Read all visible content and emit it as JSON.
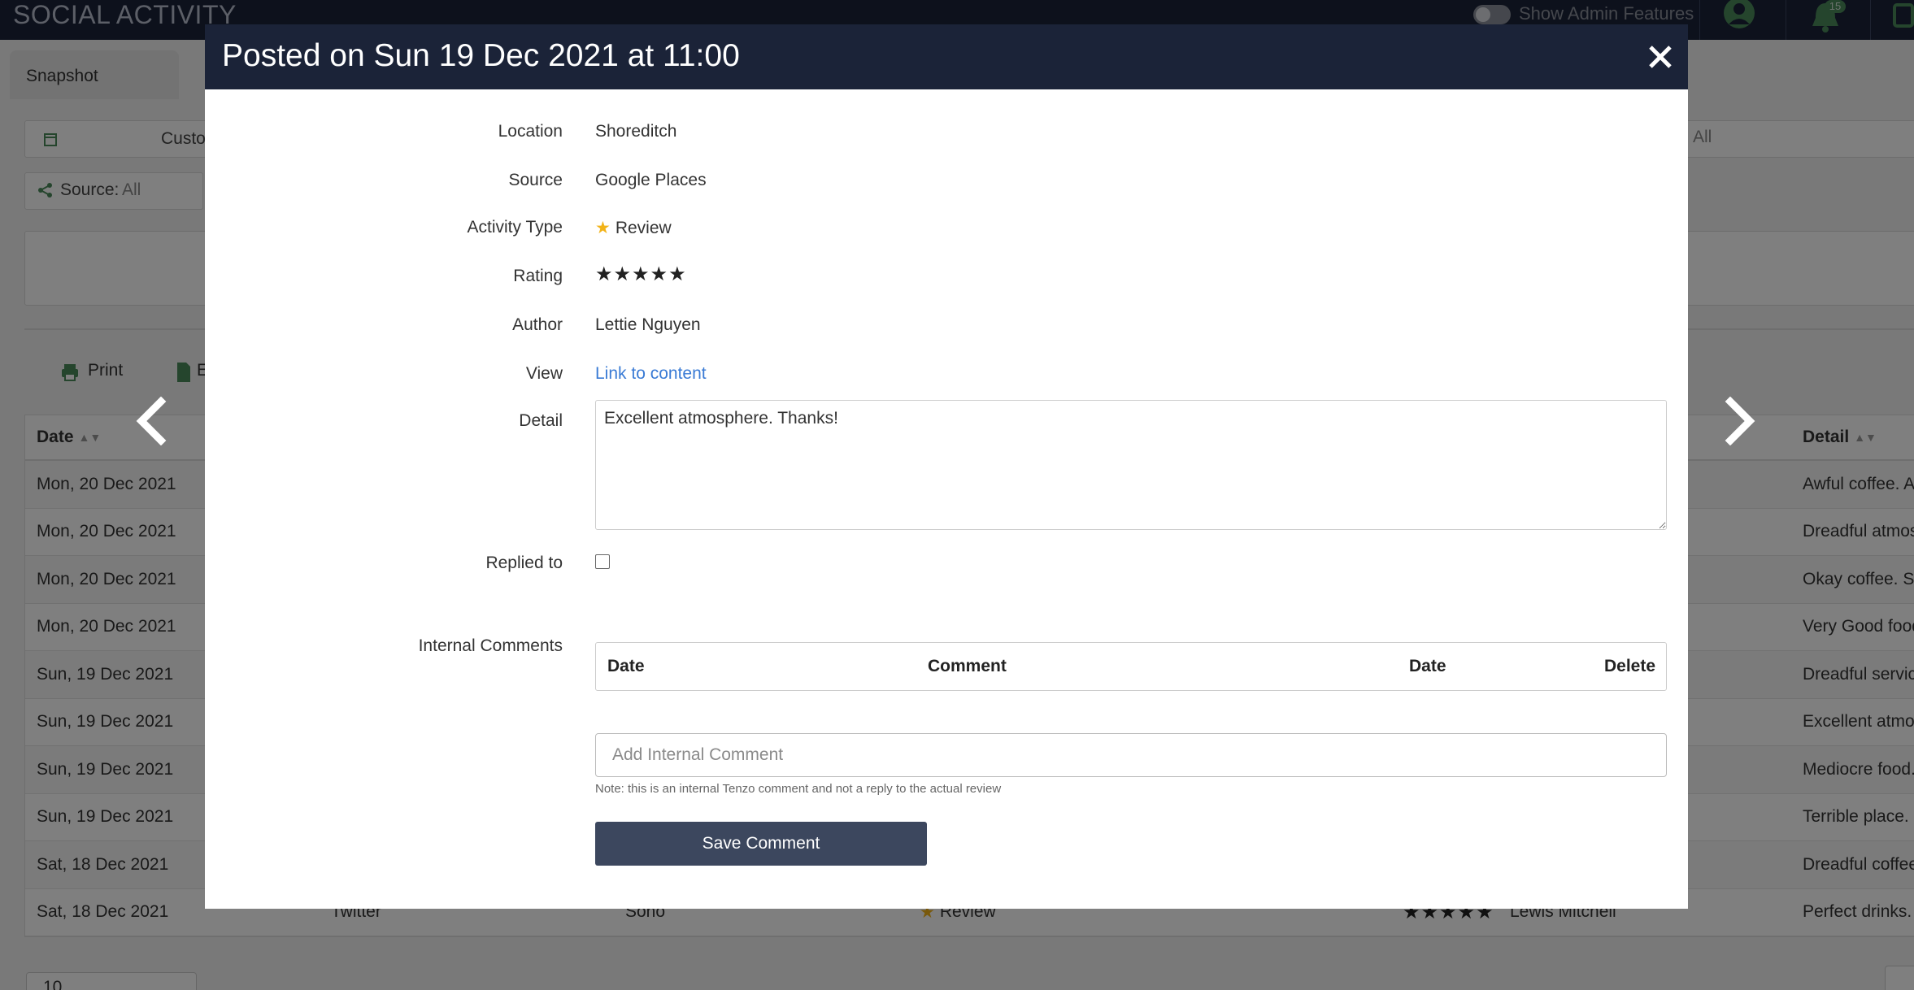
{
  "app": {
    "title": "SOCIAL ACTIVITY",
    "admin_toggle_label": "Show Admin Features",
    "notification_count": "15"
  },
  "tabs": {
    "snapshot": "Snapshot"
  },
  "filters": {
    "date_range": "Custo",
    "source_label": "Source:",
    "source_value": "All",
    "right_value": "All"
  },
  "toolbar": {
    "print": "Print",
    "export": "E"
  },
  "table": {
    "headers": {
      "date": "Date",
      "detail": "Detail"
    },
    "rows": [
      {
        "date": "Mon, 20 Dec 2021",
        "detail": "Awful coffee. A"
      },
      {
        "date": "Mon, 20 Dec 2021",
        "detail": "Dreadful atmos"
      },
      {
        "date": "Mon, 20 Dec 2021",
        "detail": "Okay coffee. Se"
      },
      {
        "date": "Mon, 20 Dec 2021",
        "detail": "Very Good food"
      },
      {
        "date": "Sun, 19 Dec 2021",
        "detail": "Dreadful servic"
      },
      {
        "date": "Sun, 19 Dec 2021",
        "detail": "Excellent atmo"
      },
      {
        "date": "Sun, 19 Dec 2021",
        "detail": "Mediocre food."
      },
      {
        "date": "Sun, 19 Dec 2021",
        "detail": "Terrible place. I"
      },
      {
        "date": "Sat, 18 Dec 2021",
        "detail": "Dreadful coffee"
      },
      {
        "date": "Sat, 18 Dec 2021",
        "source": "Twitter",
        "location": "Soho",
        "type": "Review",
        "rating": "★★★★★",
        "author": "Lewis Mitchell",
        "detail": "Perfect drinks."
      }
    ],
    "page_size": "10"
  },
  "modal": {
    "title": "Posted on Sun 19 Dec 2021 at 11:00",
    "labels": {
      "location": "Location",
      "source": "Source",
      "activity_type": "Activity Type",
      "rating": "Rating",
      "author": "Author",
      "view": "View",
      "detail": "Detail",
      "replied_to": "Replied to",
      "internal_comments": "Internal Comments"
    },
    "values": {
      "location": "Shoreditch",
      "source": "Google Places",
      "activity_type": "Review",
      "rating": "★★★★★",
      "author": "Lettie Nguyen",
      "view_link": "Link to content",
      "detail": "Excellent atmosphere. Thanks!"
    },
    "replied_to_checked": false,
    "comments_table": {
      "headers": {
        "date": "Date",
        "comment": "Comment",
        "date2": "Date",
        "delete": "Delete"
      }
    },
    "comment_input_placeholder": "Add Internal Comment",
    "note": "Note: this is an internal Tenzo comment and not a reply to the actual review",
    "save_label": "Save Comment"
  },
  "colors": {
    "header_bg": "#1b2338",
    "link": "#3a7bd5",
    "save_button": "#3c475e",
    "star_icon": "#f2b318"
  }
}
